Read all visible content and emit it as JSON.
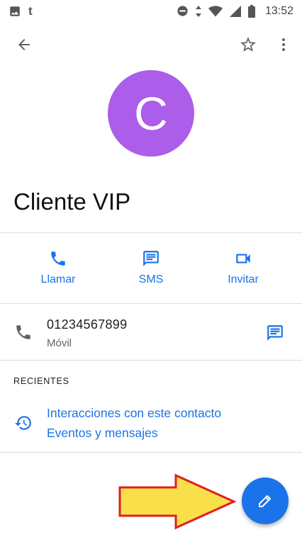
{
  "status_bar": {
    "time": "13:52",
    "app_letter": "t",
    "icons": [
      "image-icon",
      "dnd-icon",
      "data-arrows-icon",
      "wifi-icon",
      "signal-icon",
      "battery-icon"
    ]
  },
  "app_bar": {
    "icons": [
      "back-arrow-icon",
      "star-outline-icon",
      "more-vert-icon"
    ]
  },
  "contact": {
    "avatar_letter": "C",
    "avatar_color": "#ac5de9",
    "name": "Cliente VIP"
  },
  "actions": [
    {
      "label": "Llamar",
      "icon": "phone-icon"
    },
    {
      "label": "SMS",
      "icon": "message-icon"
    },
    {
      "label": "Invitar",
      "icon": "video-icon"
    }
  ],
  "phone": {
    "number": "01234567899",
    "type": "Móvil"
  },
  "recent": {
    "title": "RECIENTES",
    "line1": "Interacciones con este contacto",
    "line2": "Eventos y mensajes"
  },
  "colors": {
    "accent": "#1a73e8",
    "annotation_arrow_fill": "#f9e04b",
    "annotation_arrow_stroke": "#e02020"
  }
}
